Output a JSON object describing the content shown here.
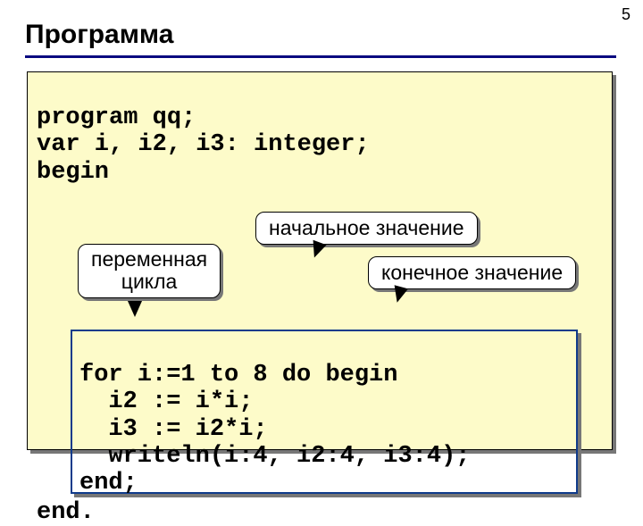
{
  "page_number": "5",
  "heading": "Программа",
  "code": {
    "l1": "program qq;",
    "l2": "var i, i2, i3: integer;",
    "l3": "begin",
    "end": "end."
  },
  "callouts": {
    "initial": "начальное значение",
    "loop_var_line1": "переменная",
    "loop_var_line2": "цикла",
    "final": "конечное значение"
  },
  "loop": {
    "l1": "for i:=1 to 8 do begin",
    "l2": "  i2 := i*i;",
    "l3": "  i3 := i2*i;",
    "l4": "  writeln(i:4, i2:4, i3:4);",
    "l5": "end;"
  }
}
